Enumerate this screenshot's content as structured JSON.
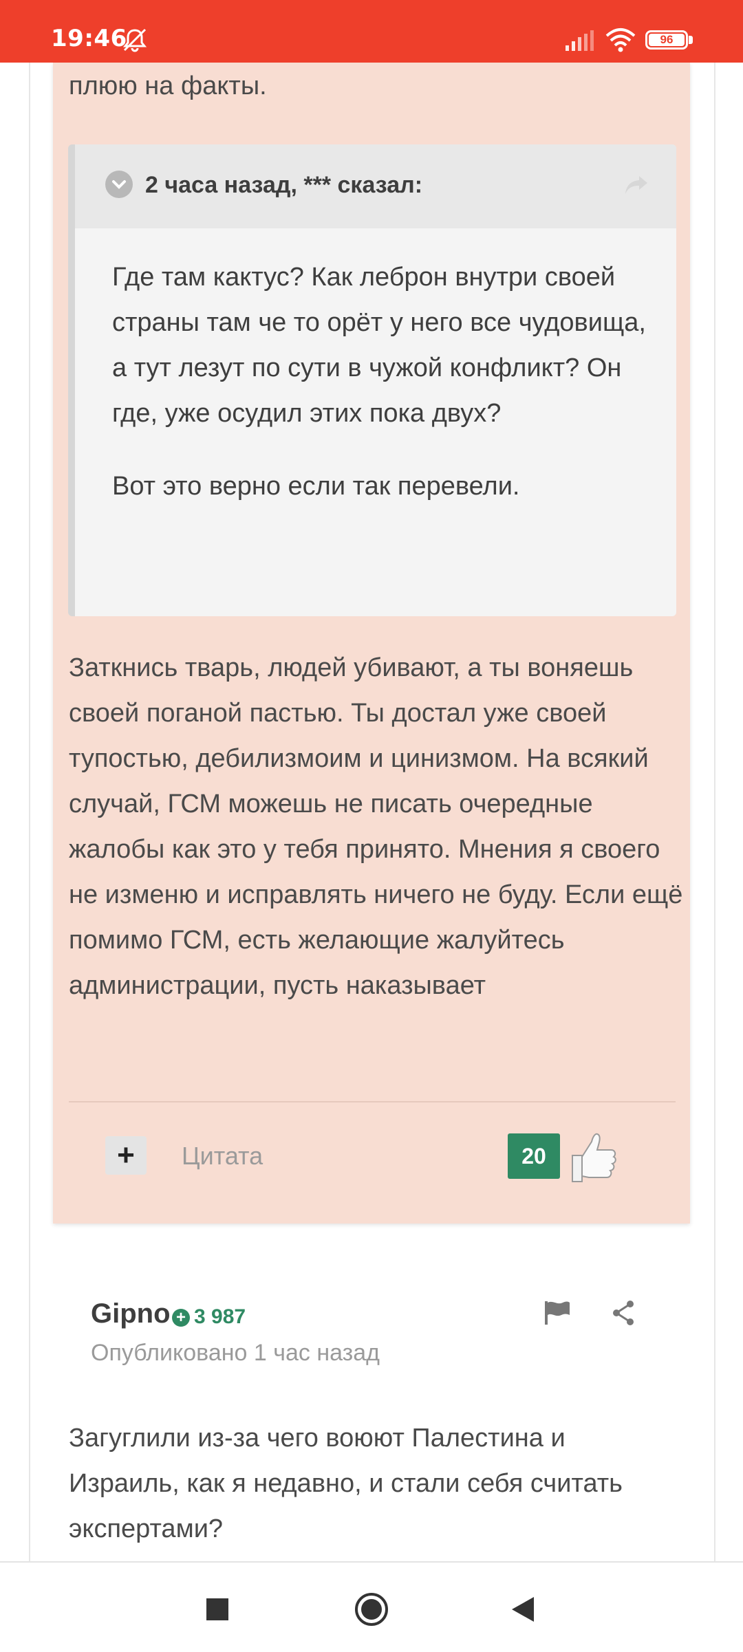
{
  "status_bar": {
    "time": "19:46",
    "battery": "96",
    "bg_color": "#ee3f2b"
  },
  "post": {
    "top_text": "плюю на факты.",
    "quote": {
      "author_line": "2 часа назад, *** сказал:",
      "paragraphs": [
        "Где там кактус? Как леброн внутри своей страны там че то орёт у него все чудовища, а тут лезут по сути в чужой конфликт? Он где, уже осудил этих пока двух?",
        "Вот это верно если так перевели."
      ]
    },
    "body": "Заткнись тварь, людей убивают, а ты воняешь своей поганой пастью. Ты достал уже своей тупостью, дебилизмоим и цинизмом. На всякий случай, ГСМ можешь не писать очередные жалобы как это у тебя принято. Мнения я своего не изменю и исправлять ничего не буду.  Если ещё помимо ГСМ, есть желающие жалуйтесь администрации, пусть наказывает",
    "actions": {
      "plus_label": "+",
      "quote_label": "Цитата",
      "likes": "20"
    },
    "highlight_color": "#f8ddd2"
  },
  "next_post": {
    "author": "Gipno",
    "reputation": "3 987",
    "published": "Опубликовано 1 час назад",
    "body": "Загуглили из-за чего воюют Палестина и Израиль, как я недавно, и стали себя считать экспертами?",
    "rep_color": "#2f8a63"
  },
  "icons": {
    "status": [
      "mute-alarm-icon",
      "signal-icon",
      "wifi-icon",
      "battery-icon"
    ],
    "nav": [
      "recents-square-icon",
      "home-circle-icon",
      "back-triangle-icon"
    ]
  }
}
